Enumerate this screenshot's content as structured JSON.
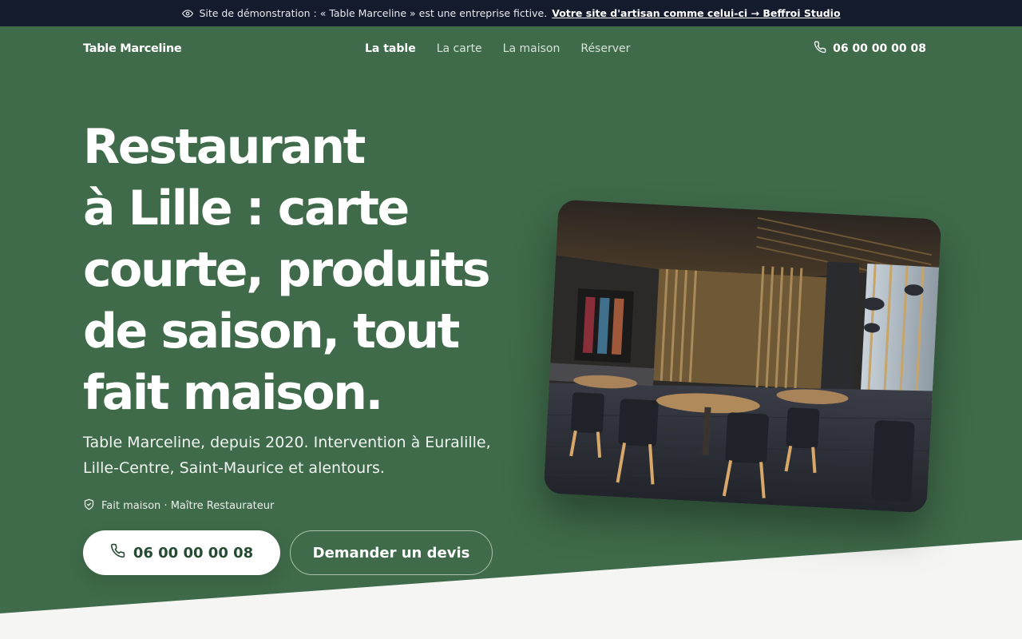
{
  "banner": {
    "text": "Site de démonstration : « Table Marceline » est une entreprise fictive.",
    "link": "Votre site d'artisan comme celui-ci → Beffroi Studio"
  },
  "nav": {
    "logo": "Table Marceline",
    "items": [
      {
        "label": "La table",
        "active": true
      },
      {
        "label": "La carte",
        "active": false
      },
      {
        "label": "La maison",
        "active": false
      },
      {
        "label": "Réserver",
        "active": false
      }
    ],
    "phone": "06 00 00 00 08"
  },
  "hero": {
    "title_lines": [
      "Restaurant",
      "à Lille : carte",
      "courte, produits",
      "de saison, tout",
      "fait maison."
    ],
    "subtitle_line1": "Table Marceline, depuis 2020. Intervention à Euralille,",
    "subtitle_line2": "Lille-Centre, Saint-Maurice et alentours.",
    "badge": "Fait maison · Maître Restaurateur",
    "cta_call": "06 00 00 00 08",
    "cta_quote": "Demander un devis"
  },
  "colors": {
    "hero_bg": "#3f6b4a",
    "banner_bg": "#141b2c",
    "wedge": "#f5f5f4",
    "button_text": "#274a33"
  },
  "icons": {
    "banner": "eye-icon",
    "phone": "phone-icon",
    "badge": "shield-check-icon"
  }
}
